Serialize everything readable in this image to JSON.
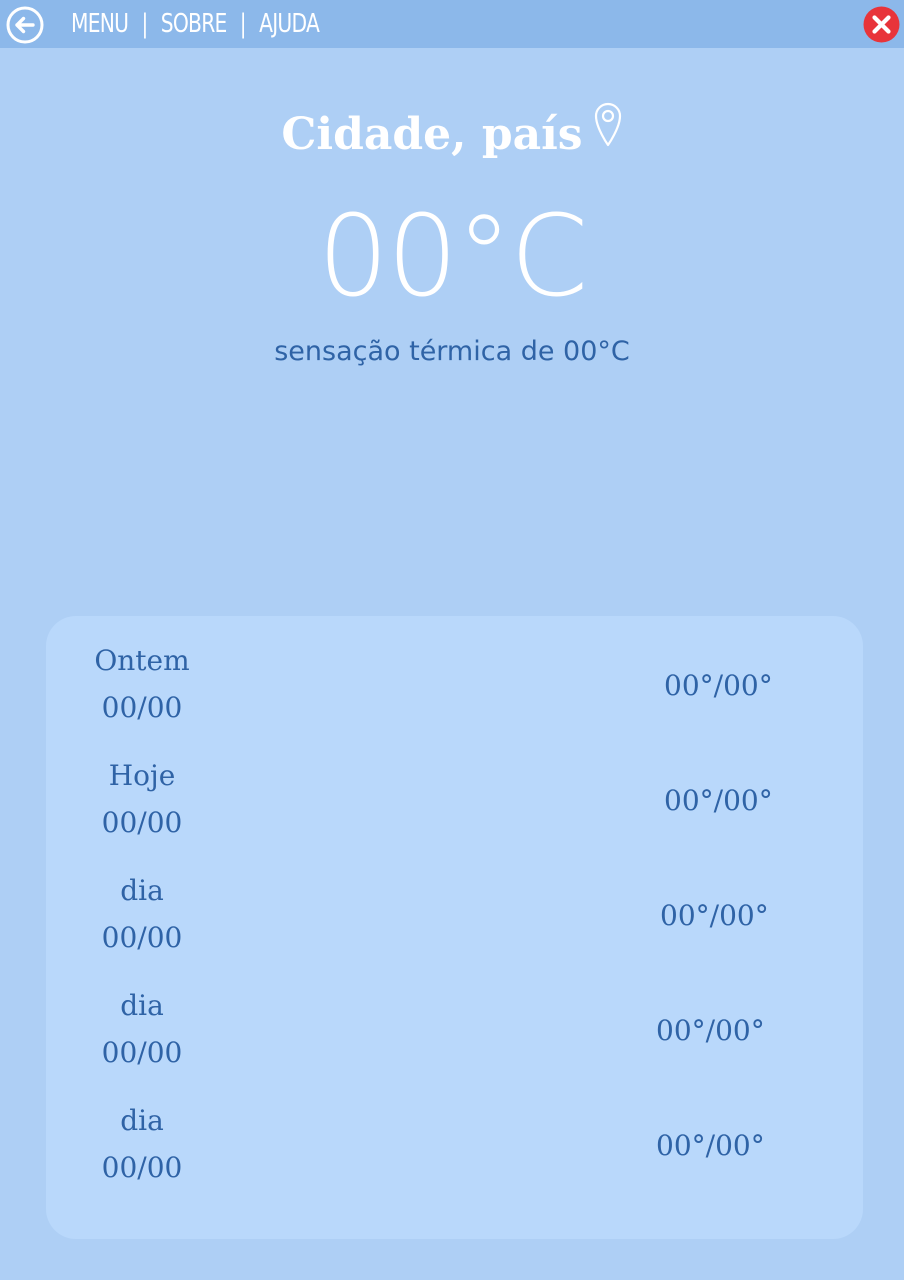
{
  "nav": {
    "items": [
      "MENU",
      "SOBRE",
      "AJUDA"
    ],
    "separator": "|"
  },
  "location": {
    "city": "Cidade, país"
  },
  "current": {
    "temperature": "00°C",
    "feels_like": "sensação térmica de 00°C"
  },
  "forecast": [
    {
      "day": "Ontem",
      "date": "00/00",
      "range": "00°/00°"
    },
    {
      "day": "Hoje",
      "date": "00/00",
      "range": "00°/00°"
    },
    {
      "day": "dia",
      "date": "00/00",
      "range": "00°/00°"
    },
    {
      "day": "dia",
      "date": "00/00",
      "range": "00°/00°"
    },
    {
      "day": "dia",
      "date": "00/00",
      "range": "00°/00°"
    }
  ],
  "colors": {
    "background": "#aecff5",
    "topbar": "#8cb8ea",
    "card": "#b9d8fb",
    "text_dark": "#2f63a6",
    "close": "#e8343a"
  }
}
